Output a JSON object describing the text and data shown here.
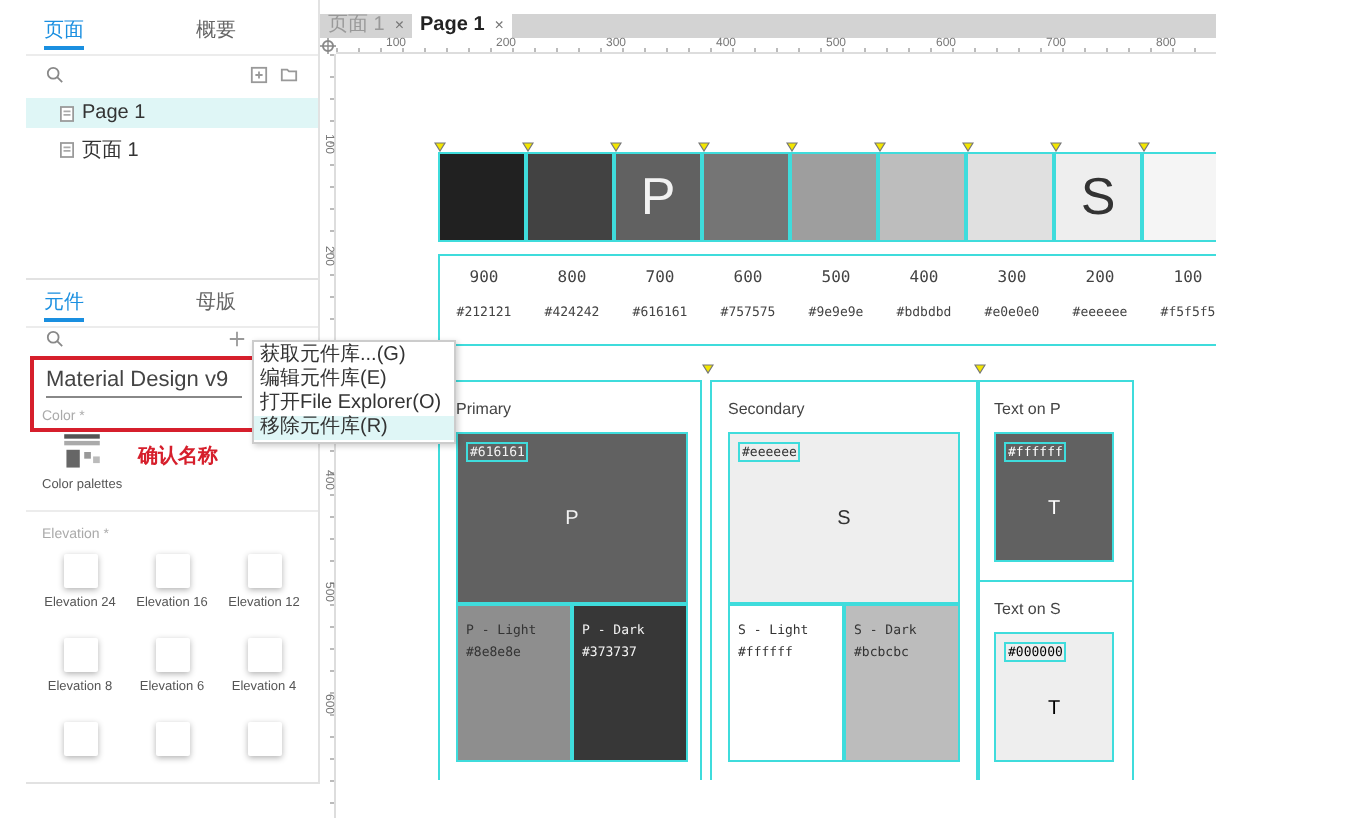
{
  "page_panel": {
    "tabs": [
      {
        "label": "页面",
        "selected": true
      },
      {
        "label": "概要",
        "selected": false
      }
    ],
    "pages": [
      {
        "name": "Page 1",
        "selected": true
      },
      {
        "name": "页面 1",
        "selected": false
      }
    ]
  },
  "library_panel": {
    "tabs": [
      {
        "label": "元件",
        "selected": true
      },
      {
        "label": "母版",
        "selected": false
      }
    ],
    "library_name": "Material Design v9",
    "color_section": {
      "title": "Color *",
      "items": [
        {
          "label": "Color palettes"
        }
      ]
    },
    "annotation": "确认名称",
    "elevation_section": {
      "title": "Elevation *",
      "items": [
        {
          "kind": "labeled",
          "label": "Elevation 24"
        },
        {
          "kind": "labeled",
          "label": "Elevation 16"
        },
        {
          "kind": "labeled",
          "label": "Elevation 12"
        },
        {
          "kind": "labeled",
          "label": "Elevation 8"
        },
        {
          "kind": "labeled",
          "label": "Elevation 6"
        },
        {
          "kind": "labeled",
          "label": "Elevation 4"
        },
        {
          "kind": "unlabeled"
        },
        {
          "kind": "unlabeled"
        },
        {
          "kind": "unlabeled"
        }
      ]
    }
  },
  "context_menu": [
    {
      "label": "获取元件库...(G)",
      "selected": false
    },
    {
      "label": "编辑元件库(E)",
      "selected": false
    },
    {
      "label": "打开File Explorer(O)",
      "selected": false
    },
    {
      "label": "移除元件库(R)",
      "selected": true
    }
  ],
  "editor_tabs": [
    {
      "label": "页面 1",
      "close": "×",
      "selected": false
    },
    {
      "label": "Page 1",
      "close": "×",
      "selected": true
    }
  ],
  "ruler": {
    "horizontal": [
      "100",
      "200",
      "300",
      "400",
      "500",
      "600",
      "700",
      "800"
    ],
    "vertical": [
      "100",
      "200",
      "400",
      "500",
      "600"
    ]
  },
  "swatches": [
    {
      "shade": "900",
      "hex": "#212121",
      "color": "#212121"
    },
    {
      "shade": "800",
      "hex": "#424242",
      "color": "#424242"
    },
    {
      "shade": "700",
      "hex": "#616161",
      "color": "#616161",
      "letter": "P"
    },
    {
      "shade": "600",
      "hex": "#757575",
      "color": "#757575"
    },
    {
      "shade": "500",
      "hex": "#9e9e9e",
      "color": "#9e9e9e"
    },
    {
      "shade": "400",
      "hex": "#bdbdbd",
      "color": "#bdbdbd"
    },
    {
      "shade": "300",
      "hex": "#e0e0e0",
      "color": "#e0e0e0"
    },
    {
      "shade": "200",
      "hex": "#eeeeee",
      "color": "#eeeeee",
      "letter": "S"
    },
    {
      "shade": "100",
      "hex": "#f5f5f5",
      "color": "#f5f5f5"
    }
  ],
  "groups": [
    {
      "kind": "palette",
      "title": "Primary",
      "main": {
        "hex": "#616161",
        "color": "#616161",
        "letter": "P"
      },
      "variants": [
        {
          "label": "P - Light",
          "hex": "#8e8e8e",
          "color": "#8e8e8e"
        },
        {
          "label": "P - Dark",
          "hex": "#373737",
          "color": "#373737"
        }
      ]
    },
    {
      "kind": "palette",
      "title": "Secondary",
      "main": {
        "hex": "#eeeeee",
        "color": "#eeeeee",
        "letter": "S"
      },
      "variants": [
        {
          "label": "S - Light",
          "hex": "#ffffff",
          "color": "#ffffff"
        },
        {
          "label": "S - Dark",
          "hex": "#bcbcbc",
          "color": "#bcbcbc"
        }
      ]
    },
    {
      "kind": "text",
      "title": "Text on P",
      "hex": "#ffffff",
      "color": "#616161",
      "letter": "T"
    },
    {
      "kind": "text",
      "title": "Text on S",
      "hex": "#000000",
      "color": "#eeeeee",
      "letter": "T"
    }
  ]
}
